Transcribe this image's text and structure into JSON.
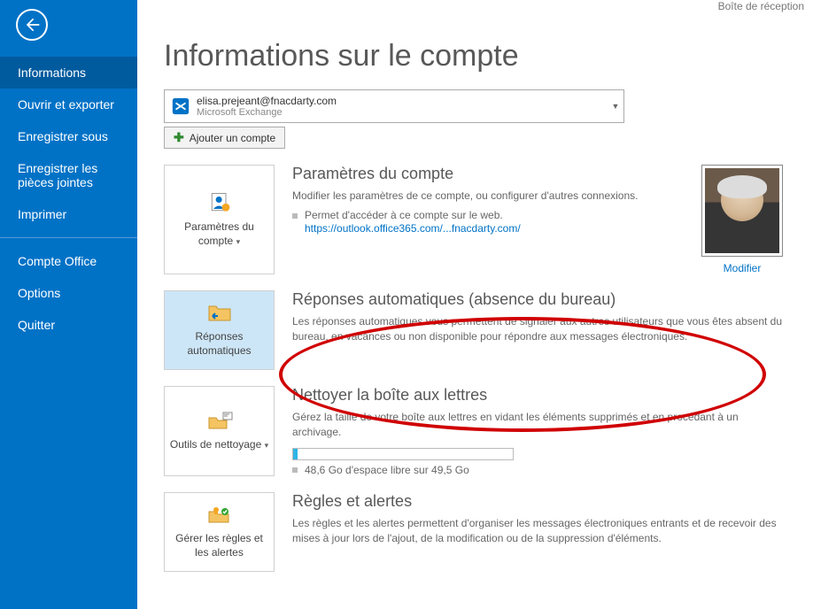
{
  "header": {
    "inbox": "Boîte de réception"
  },
  "sidebar": {
    "items": [
      "Informations",
      "Ouvrir et exporter",
      "Enregistrer sous",
      "Enregistrer les pièces jointes",
      "Imprimer"
    ],
    "bottom": [
      "Compte Office",
      "Options",
      "Quitter"
    ]
  },
  "page": {
    "title": "Informations sur le compte"
  },
  "account": {
    "email": "elisa.prejeant@fnacdarty.com",
    "type": "Microsoft Exchange",
    "add": "Ajouter un compte"
  },
  "sec1": {
    "btn": "Paramètres du compte",
    "title": "Paramètres du compte",
    "desc": "Modifier les paramètres de ce compte, ou configurer d'autres connexions.",
    "bullet": "Permet d'accéder à ce compte sur le web.",
    "link": "https://outlook.office365.com/...fnacdarty.com/",
    "modify": "Modifier"
  },
  "sec2": {
    "btn": "Réponses automatiques",
    "title": "Réponses automatiques (absence du bureau)",
    "desc": "Les réponses automatiques vous permettent de signaler aux autres utilisateurs que vous êtes absent du bureau, en vacances ou non disponible pour répondre aux messages électroniques."
  },
  "sec3": {
    "btn": "Outils de nettoyage",
    "title": "Nettoyer la boîte aux lettres",
    "desc": "Gérez la taille de votre boîte aux lettres en vidant les éléments supprimés et en procédant à un archivage.",
    "storage": "48,6 Go d'espace libre sur 49,5 Go"
  },
  "sec4": {
    "btn": "Gérer les règles et les alertes",
    "title": "Règles et alertes",
    "desc": "Les règles et les alertes permettent d'organiser les messages électroniques entrants et de recevoir des mises à jour lors de l'ajout, de la modification ou de la suppression d'éléments."
  }
}
